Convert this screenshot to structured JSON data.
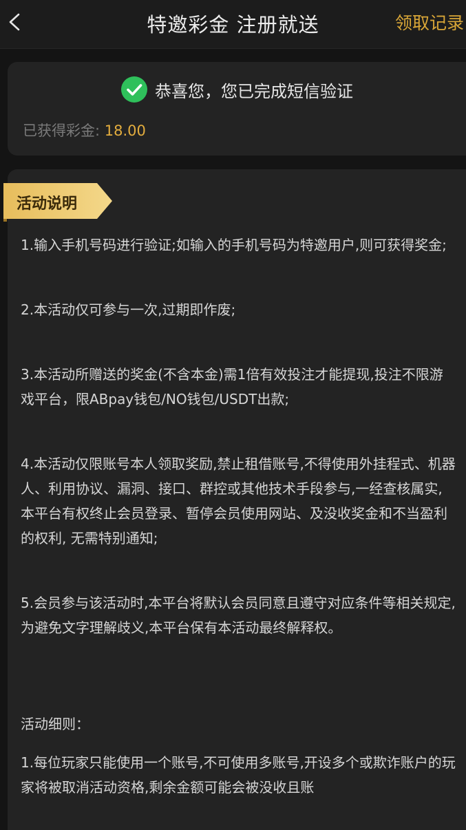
{
  "header": {
    "title": "特邀彩金 注册就送",
    "records_label": "领取记录"
  },
  "verify": {
    "message": "恭喜您，您已完成短信验证",
    "bonus_label": "已获得彩金: ",
    "bonus_value": "18.00"
  },
  "section": {
    "badge_label": "活动说明",
    "rules": [
      "1.输入手机号码进行验证;如输入的手机号码为特邀用户,则可获得奖金;",
      "2.本活动仅可参与一次,过期即作废;",
      "3.本活动所赠送的奖金(不含本金)需1倍有效投注才能提现,投注不限游戏平台，限ABpay钱包/NO钱包/USDT出款;",
      "4.本活动仅限账号本人领取奖励,禁止租借账号,不得使用外挂程式、机器人、利用协议、漏洞、接口、群控或其他技术手段参与,一经查核属实,本平台有权终止会员登录、暂停会员使用网站、及没收奖金和不当盈利的权利, 无需特别通知;",
      "5.会员参与该活动时,本平台将默认会员同意且遵守对应条件等相关规定,为避免文字理解歧义,本平台保有本活动最终解释权。"
    ],
    "details_heading": "活动细则：",
    "details": [
      "1.每位玩家只能使用一个账号,不可使用多账号,开设多个或欺诈账户的玩家将被取消活动资格,剩余金额可能会被没收且账"
    ]
  },
  "colors": {
    "background": "#141414",
    "card": "#232323",
    "accent": "#d9a637",
    "success": "#2fc05b"
  },
  "icons": {
    "back": "chevron-left-icon",
    "verified": "check-circle-icon",
    "badge": "ribbon-banner"
  }
}
